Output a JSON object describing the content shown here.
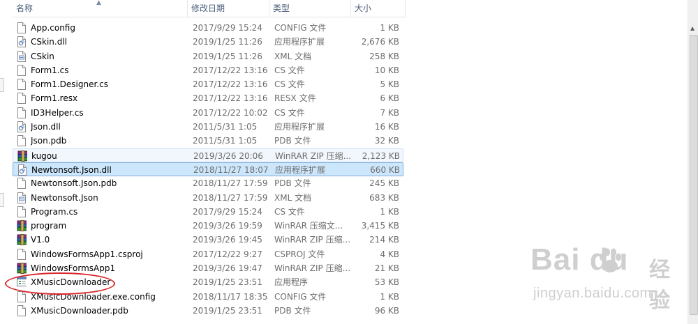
{
  "columns": {
    "name": "名称",
    "date": "修改日期",
    "type": "类型",
    "size": "大小"
  },
  "files": [
    {
      "name": "App.config",
      "date": "2017/9/29 15:24",
      "type": "CONFIG 文件",
      "size": "1 KB",
      "icon": "config-file-icon"
    },
    {
      "name": "CSkin.dll",
      "date": "2019/1/25 11:26",
      "type": "应用程序扩展",
      "size": "2,676 KB",
      "icon": "dll-file-icon"
    },
    {
      "name": "CSkin",
      "date": "2019/1/25 11:26",
      "type": "XML 文档",
      "size": "258 KB",
      "icon": "xml-file-icon"
    },
    {
      "name": "Form1.cs",
      "date": "2017/12/22 13:16",
      "type": "CS 文件",
      "size": "10 KB",
      "icon": "file-icon"
    },
    {
      "name": "Form1.Designer.cs",
      "date": "2017/12/22 13:16",
      "type": "CS 文件",
      "size": "5 KB",
      "icon": "file-icon"
    },
    {
      "name": "Form1.resx",
      "date": "2017/12/22 13:16",
      "type": "RESX 文件",
      "size": "6 KB",
      "icon": "file-icon"
    },
    {
      "name": "ID3Helper.cs",
      "date": "2017/12/22 10:02",
      "type": "CS 文件",
      "size": "7 KB",
      "icon": "file-icon"
    },
    {
      "name": "Json.dll",
      "date": "2011/5/31 1:05",
      "type": "应用程序扩展",
      "size": "16 KB",
      "icon": "dll-file-icon"
    },
    {
      "name": "Json.pdb",
      "date": "2011/5/31 1:05",
      "type": "PDB 文件",
      "size": "32 KB",
      "icon": "file-icon"
    },
    {
      "name": "kugou",
      "date": "2019/3/26 20:06",
      "type": "WinRAR ZIP 压缩...",
      "size": "2,123 KB",
      "icon": "winrar-archive-icon",
      "state": "hover"
    },
    {
      "name": "Newtonsoft.Json.dll",
      "date": "2018/11/27 18:07",
      "type": "应用程序扩展",
      "size": "660 KB",
      "icon": "dll-file-icon",
      "state": "selected"
    },
    {
      "name": "Newtonsoft.Json.pdb",
      "date": "2018/11/27 17:59",
      "type": "PDB 文件",
      "size": "245 KB",
      "icon": "file-icon"
    },
    {
      "name": "Newtonsoft.Json",
      "date": "2018/11/27 17:59",
      "type": "XML 文档",
      "size": "683 KB",
      "icon": "xml-file-icon"
    },
    {
      "name": "Program.cs",
      "date": "2017/9/29 15:24",
      "type": "CS 文件",
      "size": "1 KB",
      "icon": "file-icon"
    },
    {
      "name": "program",
      "date": "2019/3/26 19:59",
      "type": "WinRAR 压缩文...",
      "size": "3,415 KB",
      "icon": "winrar-archive-icon"
    },
    {
      "name": "V1.0",
      "date": "2019/3/26 19:45",
      "type": "WinRAR ZIP 压缩...",
      "size": "214 KB",
      "icon": "winrar-archive-icon"
    },
    {
      "name": "WindowsFormsApp1.csproj",
      "date": "2017/12/22 9:27",
      "type": "CSPROJ 文件",
      "size": "4 KB",
      "icon": "file-icon"
    },
    {
      "name": "WindowsFormsApp1",
      "date": "2019/3/26 19:47",
      "type": "WinRAR ZIP 压缩...",
      "size": "21 KB",
      "icon": "winrar-archive-icon"
    },
    {
      "name": "XMusicDownloader",
      "date": "2019/1/25 23:51",
      "type": "应用程序",
      "size": "53 KB",
      "icon": "application-exe-icon"
    },
    {
      "name": "XMusicDownloader.exe.config",
      "date": "2018/11/17 18:35",
      "type": "CONFIG 文件",
      "size": "1 KB",
      "icon": "config-file-icon"
    },
    {
      "name": "XMusicDownloader.pdb",
      "date": "2019/1/25 23:51",
      "type": "PDB 文件",
      "size": "96 KB",
      "icon": "file-icon"
    }
  ],
  "watermark": {
    "logo": "Bai  du",
    "cn": "经验",
    "url": "jingyan.baidu.com"
  },
  "colors": {
    "selected_bg": "#cce6fb",
    "selected_border": "#84acdd",
    "hover_bg": "#f1f7fd",
    "annotation": "#d8262b"
  }
}
